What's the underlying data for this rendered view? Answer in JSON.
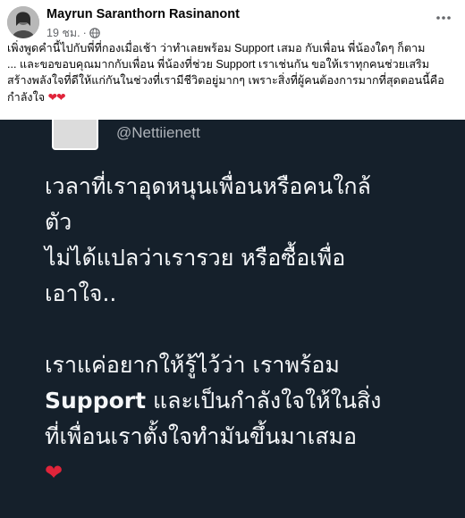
{
  "post": {
    "author": "Mayrun Saranthorn Rasinanont",
    "time": "19 ชม.",
    "separator": "·",
    "caption_lines": [
      "เพิ่งพูดคำนี้ไปกับพี่ที่กองเมื่อเช้า ว่าทำเลยพร้อม Support  เสมอ กับเพื่อน พี่น้องใดๆ ก็ตาม",
      "... และขอขอบคุณมากกับเพื่อน พี่น้องที่ช่วย Support เราเช่นกัน ขอให้เราทุกคนช่วยเสริม",
      "สร้างพลังใจที่ดีให้แก่กันในช่วงที่เรามีชีวิตอยู่มากๆ เพราะสิ่งที่ผู้คนต้องการมากที่สุดตอนนี้คือ",
      "กำลังใจ"
    ],
    "caption_hearts": "❤❤"
  },
  "card": {
    "handle": "@Nettiienett",
    "lines": [
      "เวลาที่เราอุดหนุนเพื่อนหรือคนใกล้",
      "ตัว",
      "ไม่ได้แปลว่าเรารวย หรือซื้อเพื่อ",
      "เอาใจ..",
      "",
      "เราแค่อยากให้รู้ไว้ว่า เราพร้อม",
      "และเป็นกำลังใจให้ในสิ่ง",
      "ที่เพื่อนเราตั้งใจทำมันขึ้นมาเสมอ"
    ],
    "bold_word": "Support",
    "heart": "❤"
  },
  "icons": {
    "globe": "globe-icon",
    "more": "more-icon"
  },
  "colors": {
    "card_bg": "#15202b",
    "heart": "#e0243a",
    "meta": "#65676b"
  }
}
